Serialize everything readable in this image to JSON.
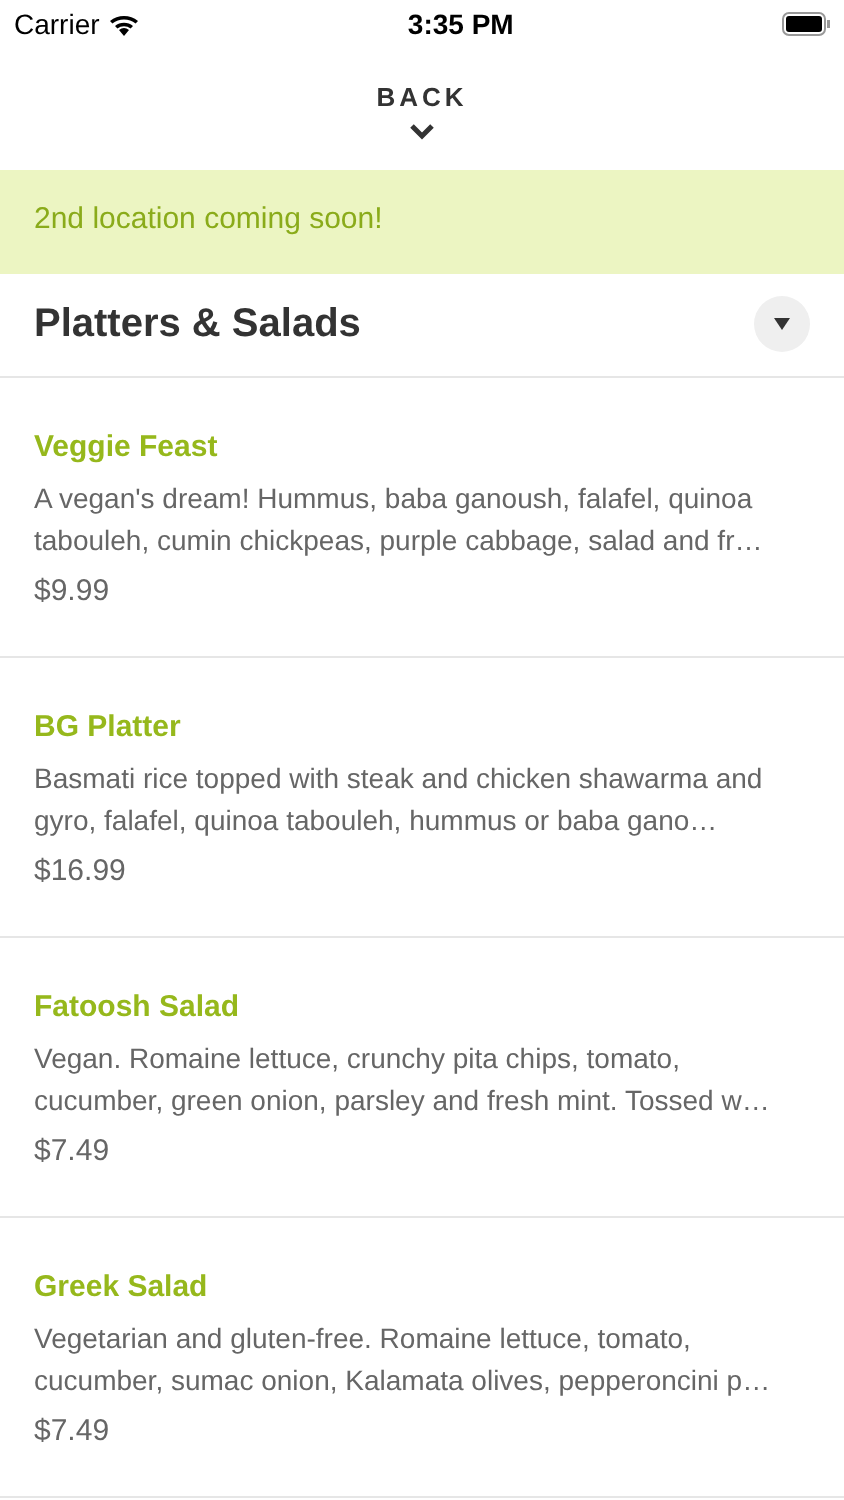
{
  "status_bar": {
    "carrier": "Carrier",
    "time": "3:35 PM"
  },
  "back": {
    "label": "BACK"
  },
  "banner": {
    "text": "2nd location coming soon!"
  },
  "section": {
    "title": "Platters & Salads",
    "expanded": true
  },
  "items": [
    {
      "name": "Veggie Feast",
      "description": "A vegan's dream! Hummus, baba ganoush, falafel, quinoa tabouleh, cumin chickpeas, purple cabbage, salad and fr…",
      "price": "$9.99"
    },
    {
      "name": "BG Platter",
      "description": "Basmati rice topped with steak and chicken shawarma and gyro, falafel, quinoa tabouleh, hummus or baba gano…",
      "price": "$16.99"
    },
    {
      "name": "Fatoosh Salad",
      "description": "Vegan. Romaine lettuce, crunchy pita chips, tomato, cucumber, green onion, parsley and fresh mint. Tossed w…",
      "price": "$7.49"
    },
    {
      "name": "Greek Salad",
      "description": "Vegetarian and gluten-free. Romaine lettuce, tomato, cucumber, sumac onion, Kalamata olives, pepperoncini p…",
      "price": "$7.49"
    }
  ]
}
